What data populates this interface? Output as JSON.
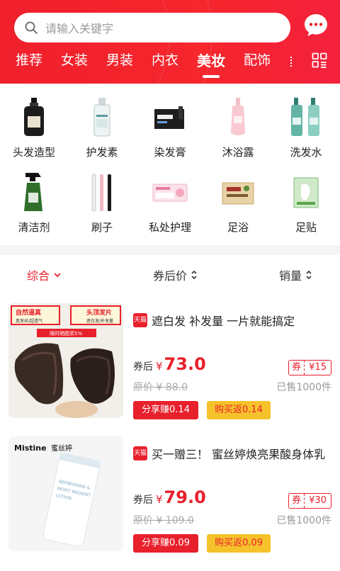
{
  "search": {
    "placeholder": "请输入关键字"
  },
  "tabs": [
    {
      "label": "推荐"
    },
    {
      "label": "女装"
    },
    {
      "label": "男装"
    },
    {
      "label": "内衣"
    },
    {
      "label": "美妆"
    },
    {
      "label": "配饰"
    }
  ],
  "active_tab": "美妆",
  "categories": [
    {
      "label": "头发造型"
    },
    {
      "label": "护发素"
    },
    {
      "label": "染发膏"
    },
    {
      "label": "沐浴露"
    },
    {
      "label": "洗发水"
    },
    {
      "label": "清洁剂"
    },
    {
      "label": "刷子"
    },
    {
      "label": "私处护理"
    },
    {
      "label": "足浴"
    },
    {
      "label": "足贴"
    }
  ],
  "sort": {
    "overall": "综合",
    "after_coupon_price": "券后价",
    "sales": "销量"
  },
  "products": [
    {
      "badge": "天猫",
      "title": "遮白发 补发量 一片就能搞定",
      "price_label": "券后",
      "currency": "¥",
      "price": "73.0",
      "coupon_label": "券",
      "coupon_value": "¥15",
      "original_price": "原价 ¥ 88.0",
      "sold": "已售1000件",
      "share_label": "分享赚0.14",
      "rebate_label": "购买返0.14",
      "image_text": {
        "tag1": "自然逼真",
        "tag1_sub": "真发丝/超透气",
        "tag2": "头顶发片",
        "tag2_sub": "遮白发/补发量",
        "banner": "限时晒图奖5%"
      }
    },
    {
      "badge": "天猫",
      "title": "买一赠三！ 蜜丝婷焕亮果酸身体乳",
      "price_label": "券后",
      "currency": "¥",
      "price": "79.0",
      "coupon_label": "券",
      "coupon_value": "¥30",
      "original_price": "原价 ¥ 109.0",
      "sold": "已售1000件",
      "share_label": "分享赚0.09",
      "rebate_label": "购买返0.09",
      "image_text": {
        "brand": "Mistine",
        "brand_cn": "蜜丝婷",
        "tube_line1": "REFRESHING &",
        "tube_line2": "MOIST RADIANT",
        "tube_line3": "LOTION"
      }
    }
  ],
  "colors": {
    "primary": "#e8202c",
    "yellow": "#f6c22b"
  }
}
